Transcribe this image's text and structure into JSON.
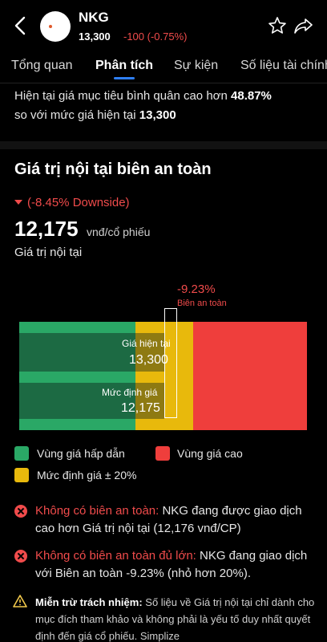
{
  "header": {
    "ticker": "NKG",
    "price": "13,300",
    "change": "-100 (-0.75%)"
  },
  "tabs": [
    {
      "label": "Tổng quan"
    },
    {
      "label": "Phân tích"
    },
    {
      "label": "Sự kiện"
    },
    {
      "label": "Số liệu tài chính"
    }
  ],
  "summary": {
    "line1_prefix": "Hiện tại giá mục tiêu bình quân cao hơn ",
    "line1_value": "48.87%",
    "line2_prefix": "so với mức giá hiện tại ",
    "line2_value": "13,300"
  },
  "intrinsic": {
    "title": "Giá trị nội tại biên an toàn",
    "downside": "(-8.45% Downside)",
    "value": "12,175",
    "unit": "vnđ/cổ phiếu",
    "label": "Giá trị nội tại"
  },
  "chart": {
    "margin_pct": "-9.23%",
    "margin_label": "Biên an toàn",
    "current_label": "Giá hiện tại",
    "current_value": "13,300",
    "fair_label": "Mức định giá",
    "fair_value": "12,175"
  },
  "legend": [
    {
      "label": "Vùng giá hấp dẫn",
      "color": "#2aa866"
    },
    {
      "label": "Vùng giá cao",
      "color": "#ef3e3c"
    },
    {
      "label": "Mức định giá ± 20%",
      "color": "#e8b90c"
    }
  ],
  "notes": [
    {
      "highlight": "Không có biên an toàn:",
      "text": " NKG đang được giao dịch cao hơn Giá trị nội tại (12,176 vnđ/CP)"
    },
    {
      "highlight": "Không có biên an toàn đủ lớn:",
      "text": " NKG đang giao dịch với Biên an toàn -9.23% (nhỏ hơn 20%)."
    }
  ],
  "disclaimer": {
    "title": "Miễn trừ trách nhiệm:",
    "text": " Số liệu về Giá trị nội tại chỉ dành cho mục đích tham khảo và không phải là yếu tố duy nhất quyết định đến giá cổ phiếu. Simplize"
  }
}
